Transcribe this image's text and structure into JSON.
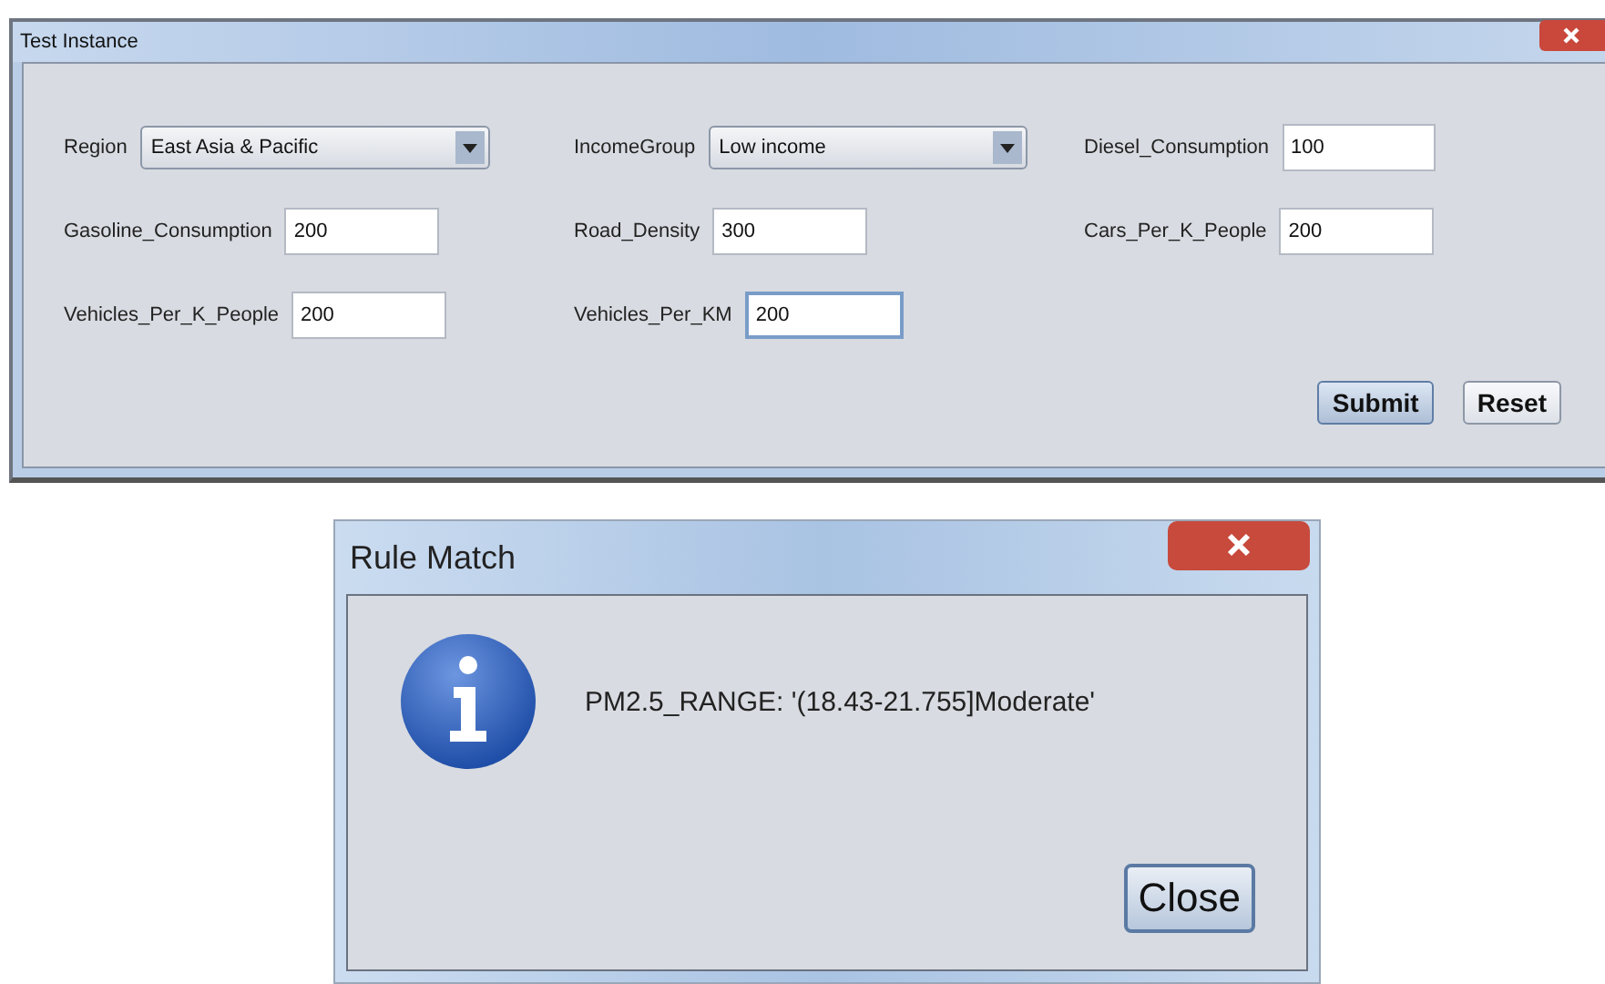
{
  "window": {
    "title": "Test Instance"
  },
  "fields": [
    {
      "label": "Region",
      "kind": "dropdown",
      "value": "East Asia & Pacific",
      "focused": false
    },
    {
      "label": "IncomeGroup",
      "kind": "dropdown",
      "value": "Low income",
      "focused": false
    },
    {
      "label": "Diesel_Consumption",
      "kind": "text",
      "value": "100",
      "focused": false
    },
    {
      "label": "Gasoline_Consumption",
      "kind": "text",
      "value": "200",
      "focused": false
    },
    {
      "label": "Road_Density",
      "kind": "text",
      "value": "300",
      "focused": false
    },
    {
      "label": "Cars_Per_K_People",
      "kind": "text",
      "value": "200",
      "focused": false
    },
    {
      "label": "Vehicles_Per_K_People",
      "kind": "text",
      "value": "200",
      "focused": false
    },
    {
      "label": "Vehicles_Per_KM",
      "kind": "text",
      "value": "200",
      "focused": true
    }
  ],
  "buttons": [
    {
      "label": "Submit",
      "focused": true
    },
    {
      "label": "Reset",
      "focused": false
    }
  ],
  "dialog": {
    "title": "Rule Match",
    "message": "PM2.5_RANGE: '(18.43-21.755]Moderate'",
    "button": "Close"
  }
}
